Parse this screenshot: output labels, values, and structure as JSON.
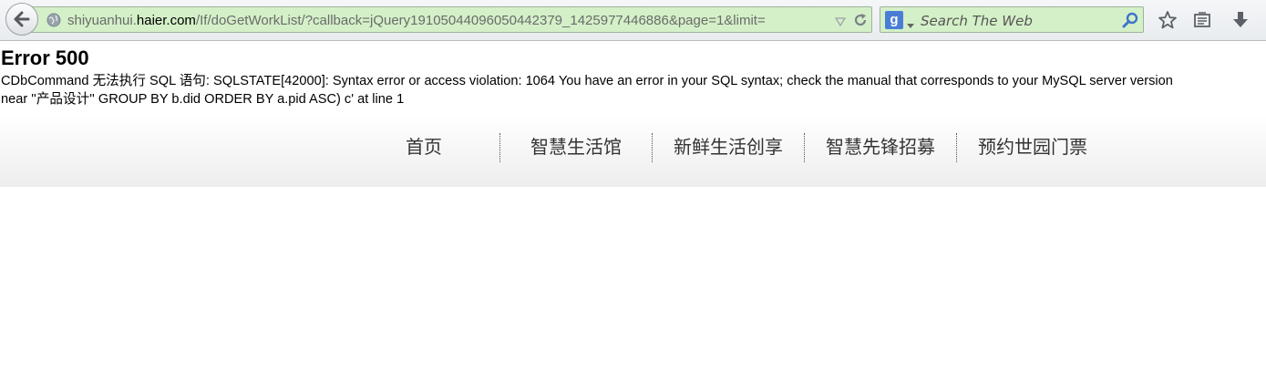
{
  "browser": {
    "url_prefix": "shiyuanhui.",
    "url_domain": "haier.com",
    "url_path": "/If/doGetWorkList/?callback=jQuery19105044096050442379_1425977446886&page=1&limit=",
    "search_placeholder": "Search The Web",
    "search_engine_letter": "g"
  },
  "error": {
    "title": "Error 500",
    "line1": "CDbCommand 无法执行 SQL 语句: SQLSTATE[42000]: Syntax error or access violation: 1064 You have an error in your SQL syntax; check the manual that corresponds to your MySQL server version",
    "line2": "near ''产品设计'' GROUP BY b.did ORDER BY a.pid ASC) c' at line 1"
  },
  "nav": {
    "items": [
      {
        "label": "首页"
      },
      {
        "label": "智慧生活馆"
      },
      {
        "label": "新鲜生活创享"
      },
      {
        "label": "智慧先锋招募"
      },
      {
        "label": "预约世园门票"
      }
    ]
  }
}
